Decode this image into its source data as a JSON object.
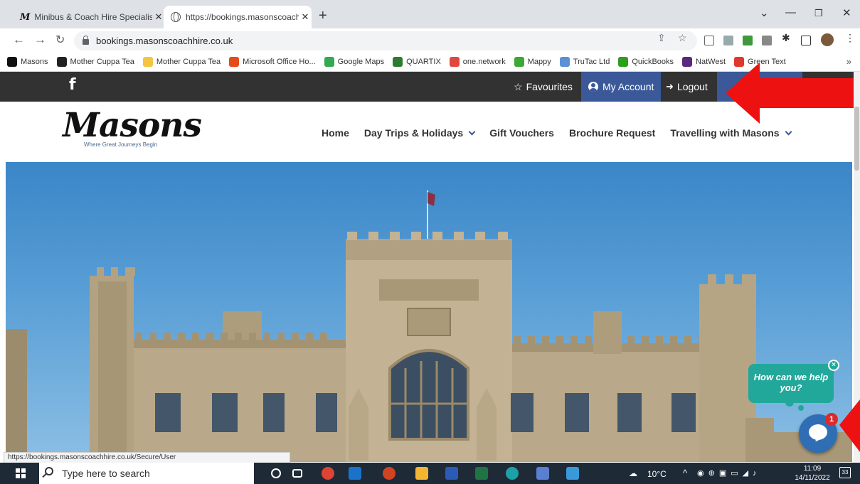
{
  "browser": {
    "tabs": [
      {
        "title": "Minibus & Coach Hire Specialists"
      },
      {
        "title": "https://bookings.masonscoachhi"
      }
    ],
    "url": "bookings.masonscoachhire.co.uk",
    "bookmarks": [
      {
        "label": "Masons",
        "icon": "masons-m-icon",
        "color": "#111111"
      },
      {
        "label": "Mother Cuppa Tea",
        "icon": "cuppa-icon",
        "color": "#222222"
      },
      {
        "label": "Mother Cuppa Tea",
        "icon": "folder-icon",
        "color": "#f4c542"
      },
      {
        "label": "Microsoft Office Ho...",
        "icon": "office-icon",
        "color": "#e64a19"
      },
      {
        "label": "Google Maps",
        "icon": "maps-pin-icon",
        "color": "#34a853"
      },
      {
        "label": "QUARTIX",
        "icon": "quartix-icon",
        "color": "#2a7d2e"
      },
      {
        "label": "one.network",
        "icon": "one-network-icon",
        "color": "#e0483e"
      },
      {
        "label": "Mappy",
        "icon": "mappy-icon",
        "color": "#3aa935"
      },
      {
        "label": "TruTac Ltd",
        "icon": "trutac-icon",
        "color": "#5b8fd6"
      },
      {
        "label": "QuickBooks",
        "icon": "quickbooks-icon",
        "color": "#2ca01c"
      },
      {
        "label": "NatWest",
        "icon": "natwest-icon",
        "color": "#5a287d"
      },
      {
        "label": "Green Text",
        "icon": "green-text-icon",
        "color": "#e0382c"
      }
    ],
    "status_url": "https://bookings.masonscoachhire.co.uk/Secure/User"
  },
  "site": {
    "topbar": {
      "facebook": "f",
      "favourites": "Favourites",
      "my_account": "My Account",
      "logout": "Logout"
    },
    "logo": {
      "name": "Masons",
      "tagline": "Where Great Journeys Begin"
    },
    "nav": [
      {
        "label": "Home",
        "dropdown": false
      },
      {
        "label": "Day Trips & Holidays",
        "dropdown": true
      },
      {
        "label": "Gift Vouchers",
        "dropdown": false
      },
      {
        "label": "Brochure Request",
        "dropdown": false
      },
      {
        "label": "Travelling with Masons",
        "dropdown": true
      }
    ],
    "chat": {
      "prompt": "How can we help you?",
      "close": "×",
      "badge": "1"
    }
  },
  "taskbar": {
    "search_placeholder": "Type here to search",
    "weather": "10°C",
    "time": "11:09",
    "date": "14/11/2022",
    "notifications": "33"
  },
  "colors": {
    "accent_blue": "#3b5998",
    "chat_teal": "#22a89a",
    "arrow_red": "#ee1111"
  }
}
